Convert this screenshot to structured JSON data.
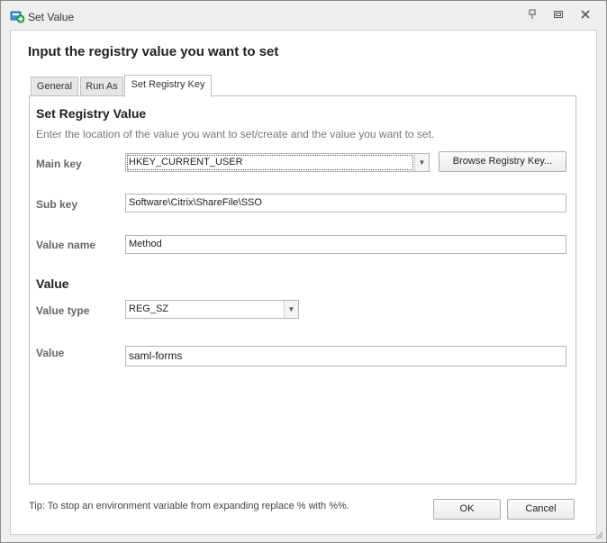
{
  "window": {
    "title": "Set Value",
    "controls": [
      "pin-icon",
      "restore-icon",
      "close-icon"
    ]
  },
  "header": {
    "heading": "Input the registry value you want to set"
  },
  "tabs": [
    {
      "label": "General",
      "active": false
    },
    {
      "label": "Run As",
      "active": false
    },
    {
      "label": "Set Registry Key",
      "active": true
    }
  ],
  "panel": {
    "section_title": "Set Registry Value",
    "description": "Enter the location of the value you want to set/create and the value you want to set.",
    "main_key": {
      "label": "Main key",
      "value": "HKEY_CURRENT_USER"
    },
    "browse_button": "Browse Registry Key...",
    "sub_key": {
      "label": "Sub key",
      "value": "Software\\Citrix\\ShareFile\\SSO"
    },
    "value_name": {
      "label": "Value name",
      "value": "Method"
    },
    "value_section_title": "Value",
    "value_type": {
      "label": "Value type",
      "value": "REG_SZ"
    },
    "value": {
      "label": "Value",
      "value": "saml-forms"
    }
  },
  "footer": {
    "tip": "Tip: To stop an environment variable from expanding replace % with %%.",
    "ok_label": "OK",
    "cancel_label": "Cancel"
  },
  "colors": {
    "background": "#eeeeee",
    "panel": "#ffffff",
    "border": "#bfbfbf"
  }
}
